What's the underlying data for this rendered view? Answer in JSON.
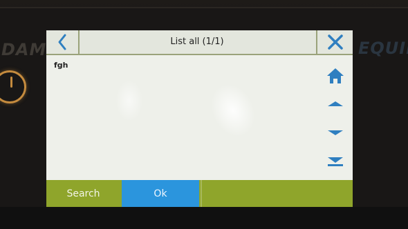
{
  "bezel": {
    "left_brand_text": "DAM",
    "right_brand_text": "EQUIN"
  },
  "header": {
    "title": "List all (1/1)",
    "back_icon": "chevron-left-icon",
    "close_icon": "close-icon"
  },
  "list": {
    "items": [
      {
        "label": "fgh"
      }
    ]
  },
  "nav": {
    "icons": [
      "home-icon",
      "arrow-up-icon",
      "arrow-down-icon",
      "arrow-to-bottom-icon"
    ]
  },
  "footer": {
    "search_label": "Search",
    "ok_label": "Ok"
  },
  "colors": {
    "accent_green": "#8fa52b",
    "accent_blue": "#2b95dd",
    "icon_blue": "#2f7fc0"
  }
}
